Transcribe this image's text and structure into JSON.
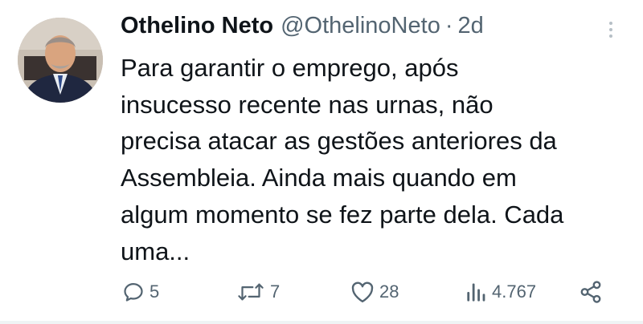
{
  "tweet": {
    "author_name": "Othelino Neto",
    "author_handle": "@OthelinoNeto",
    "separator": "·",
    "time": "2d",
    "text": "Para garantir o emprego, após\ninsucesso recente nas urnas, não\nprecisa atacar as gestões anteriores da\nAssembleia. Ainda mais quando em\nalgum momento se fez parte dela. Cada\numa..."
  },
  "actions": {
    "replies": "5",
    "reposts": "7",
    "likes": "28",
    "views": "4.767"
  },
  "icons": {
    "more": "more-vertical-icon",
    "reply": "reply-icon",
    "repost": "repost-icon",
    "like": "heart-icon",
    "views": "views-icon",
    "share": "share-icon"
  },
  "colors": {
    "text": "#0f1419",
    "secondary": "#536471"
  }
}
